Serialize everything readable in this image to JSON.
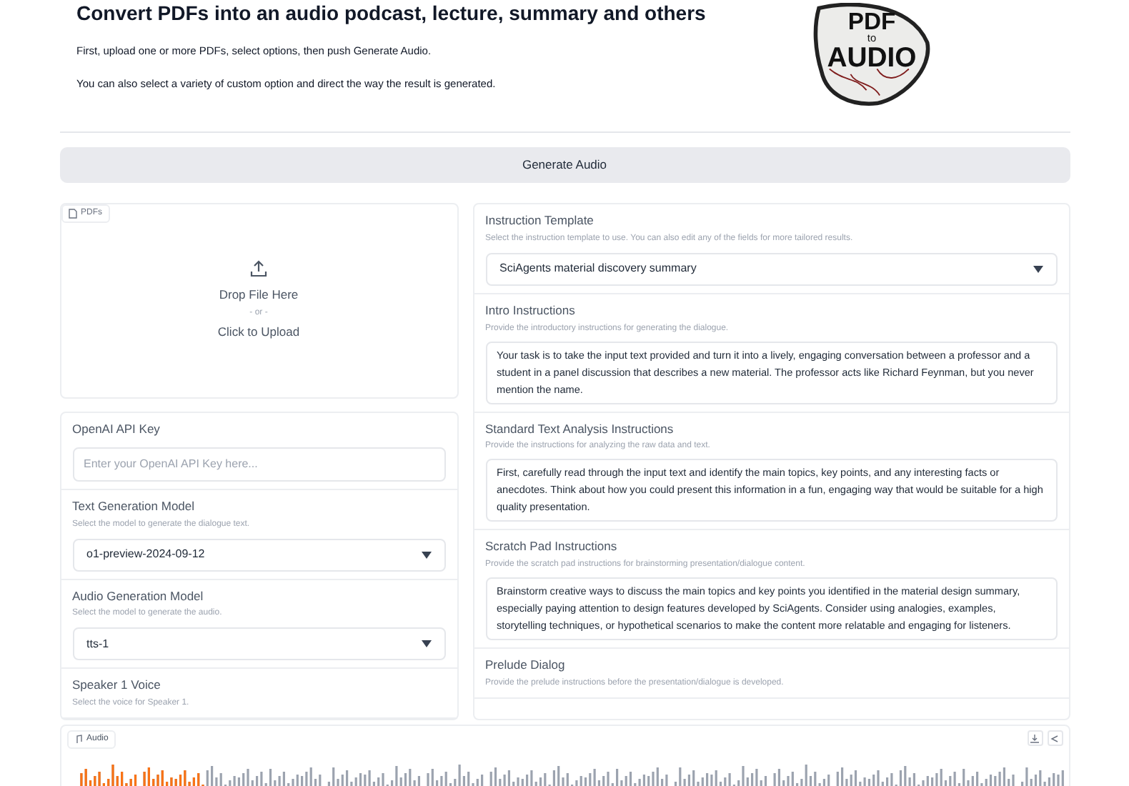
{
  "header": {
    "title": "Convert PDFs into an audio podcast, lecture, summary and others",
    "lines": [
      "First, upload one or more PDFs, select options, then push Generate Audio.",
      "You can also select a variety of custom option and direct the way the result is generated."
    ],
    "logo": {
      "top": "PDF",
      "middle": "to",
      "bottom": "AUDIO"
    }
  },
  "generate_button": "Generate Audio",
  "upload": {
    "tab_label": "PDFs",
    "drop": "Drop File Here",
    "or": "- or -",
    "click": "Click to Upload"
  },
  "left_settings": [
    {
      "kind": "text",
      "label": "OpenAI API Key",
      "placeholder": "Enter your OpenAI API Key here..."
    },
    {
      "kind": "dropdown",
      "label": "Text Generation Model",
      "hint": "Select the model to generate the dialogue text.",
      "value": "o1-preview-2024-09-12"
    },
    {
      "kind": "dropdown",
      "label": "Audio Generation Model",
      "hint": "Select the model to generate the audio.",
      "value": "tts-1"
    },
    {
      "kind": "heading",
      "label": "Speaker 1 Voice",
      "hint": "Select the voice for Speaker 1."
    }
  ],
  "right_settings": [
    {
      "kind": "dropdown",
      "label": "Instruction Template",
      "hint": "Select the instruction template to use. You can also edit any of the fields for more tailored results.",
      "value": "SciAgents material discovery summary"
    },
    {
      "kind": "textarea",
      "label": "Intro Instructions",
      "hint": "Provide the introductory instructions for generating the dialogue.",
      "value": "Your task is to take the input text provided and turn it into a lively, engaging conversation between a professor and a student in a panel discussion that describes a new material. The professor acts like Richard Feynman, but you never mention the name."
    },
    {
      "kind": "textarea",
      "label": "Standard Text Analysis Instructions",
      "hint": "Provide the instructions for analyzing the raw data and text.",
      "value": "First, carefully read through the input text and identify the main topics, key points, and any interesting facts or anecdotes. Think about how you could present this information in a fun, engaging way that would be suitable for a high quality presentation."
    },
    {
      "kind": "textarea",
      "label": "Scratch Pad Instructions",
      "hint": "Provide the scratch pad instructions for brainstorming presentation/dialogue content.",
      "value": "Brainstorm creative ways to discuss the main topics and key points you identified in the material design summary, especially paying attention to design features developed by SciAgents. Consider using analogies, examples, storytelling techniques, or hypothetical scenarios to make the content more relatable and engaging for listeners."
    },
    {
      "kind": "heading",
      "label": "Prelude Dialog",
      "hint": "Provide the prelude instructions before the presentation/dialogue is developed."
    }
  ],
  "audio": {
    "label": "Audio",
    "level": 0.13
  }
}
